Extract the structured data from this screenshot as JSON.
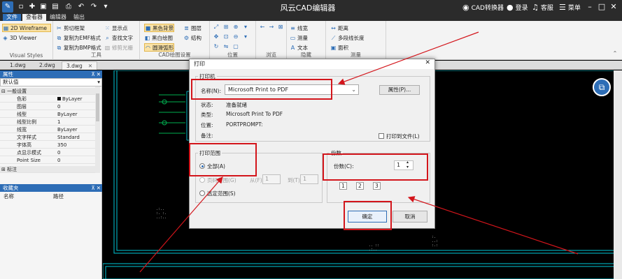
{
  "app": {
    "title": "风云CAD编辑器",
    "converter": "CAD转换器",
    "login": "登录",
    "support": "客服",
    "menu": "菜单"
  },
  "menubar": {
    "tabs": [
      "文件",
      "查看器",
      "编辑器",
      "输出"
    ]
  },
  "ribbon": {
    "visual_styles": {
      "title": "Visual Styles",
      "wireframe": "2D Wireframe",
      "viewer3d": "3D Viewer"
    },
    "tools": {
      "title": "工具",
      "clip_frame": "剪切框架",
      "copy_emf": "复制为EMF格式",
      "copy_bmp": "复制为BMP格式",
      "show_points": "显示点",
      "find_text": "查找文字",
      "trim_raster": "修剪光栅"
    },
    "cad_settings": {
      "title": "CAD绘图设置",
      "black_bg": "黑色背景",
      "bw_draw": "黑白绘图",
      "smooth_arc": "圆滑弧形",
      "layers": "图层",
      "structure": "结构"
    },
    "position": {
      "title": "位置"
    },
    "browse": {
      "title": "浏览"
    },
    "hide": {
      "title": "隐藏",
      "linewidth": "线宽",
      "measure": "测量",
      "text": "文本"
    },
    "measure": {
      "title": "测量",
      "distance": "距离",
      "polyline_length": "多段线长度",
      "area": "面积"
    }
  },
  "doc_tabs": [
    "1.dwg",
    "2.dwg",
    "3.dwg"
  ],
  "properties": {
    "header": "属性",
    "dropdown": "默认值",
    "general_group": "一般设置",
    "rows": [
      {
        "k": "色彩",
        "v": "ByLayer"
      },
      {
        "k": "图层",
        "v": "0"
      },
      {
        "k": "线型",
        "v": "ByLayer"
      },
      {
        "k": "线型比例",
        "v": "1"
      },
      {
        "k": "线宽",
        "v": "ByLayer"
      },
      {
        "k": "文字样式",
        "v": "Standard"
      },
      {
        "k": "字体高",
        "v": "350"
      },
      {
        "k": "点显示模式",
        "v": "0"
      },
      {
        "k": "Point Size",
        "v": "0"
      }
    ],
    "dim_group": "标注",
    "favorites": "收藏夹",
    "col_name": "名称",
    "col_path": "路径"
  },
  "print_dialog": {
    "title": "打印",
    "printer_section": "打印机",
    "name_label": "名称(N):",
    "printer_name": "Microsoft Print to PDF",
    "properties_button": "属性(P)...",
    "status_label": "状态:",
    "status_value": "准备就绪",
    "type_label": "类型:",
    "type_value": "Microsoft Print To PDF",
    "where_label": "位置:",
    "where_value": "PORTPROMPT:",
    "comment_label": "备注:",
    "print_to_file": "打印到文件(L)",
    "range_section": "打印范围",
    "range_all": "全部(A)",
    "range_pages": "页码范围(G)",
    "from_label": "从(F):",
    "to_label": "到(T):",
    "from_value": "1",
    "to_value": "1",
    "range_selection": "选定范围(S)",
    "copies_section": "份数",
    "copies_label": "份数(C):",
    "copies_value": "1",
    "collate_icons": [
      "1",
      "2",
      "3"
    ],
    "ok_button": "确定",
    "cancel_button": "取消"
  },
  "colors": {
    "highlight": "#d3151b",
    "accent": "#2d6db6",
    "drawing": "#00c8d8"
  }
}
